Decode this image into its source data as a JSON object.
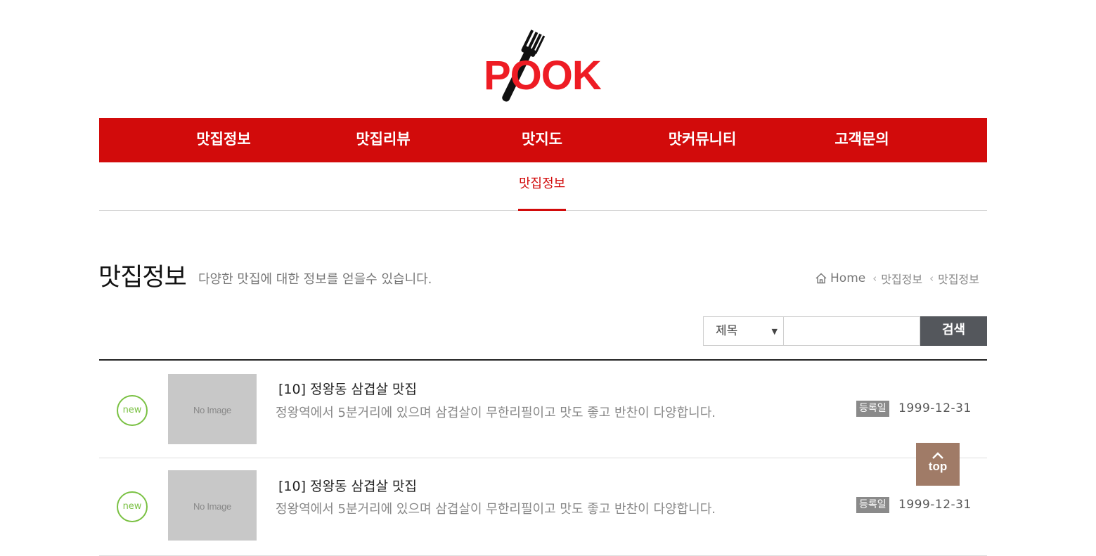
{
  "logo": {
    "text": "POOK",
    "icon": "fork-icon",
    "color": "#d20b0b"
  },
  "gnb": {
    "items": [
      "맛집정보",
      "맛집리뷰",
      "맛지도",
      "맛커뮤니티",
      "고객문의"
    ],
    "background": "#d20b0b"
  },
  "snb": {
    "active": "맛집정보"
  },
  "header": {
    "title": "맛집정보",
    "description": "다양한 맛집에 대한 정보를 얻을수 있습니다.",
    "breadcrumb": [
      "Home",
      "맛집정보",
      "맛집정보"
    ]
  },
  "search": {
    "select_value": "제목",
    "input_value": "",
    "button_label": "검색"
  },
  "list": [
    {
      "badge": "new",
      "thumb": "No Image",
      "title": "[10] 정왕동 삼겹살 맛집",
      "desc": "정왕역에서 5분거리에 있으며 삼겹살이 무한리필이고 맛도 좋고 반찬이 다양합니다.",
      "date_label": "등록일",
      "date": "1999-12-31"
    },
    {
      "badge": "new",
      "thumb": "No Image",
      "title": "[10] 정왕동 삼겹살 맛집",
      "desc": "정왕역에서 5분거리에 있으며 삼겹살이 무한리필이고 맛도 좋고 반찬이 다양합니다.",
      "date_label": "등록일",
      "date": "1999-12-31"
    }
  ],
  "top_button": {
    "label": "top",
    "icon": "chevron-up-icon",
    "color": "#a07b67"
  }
}
